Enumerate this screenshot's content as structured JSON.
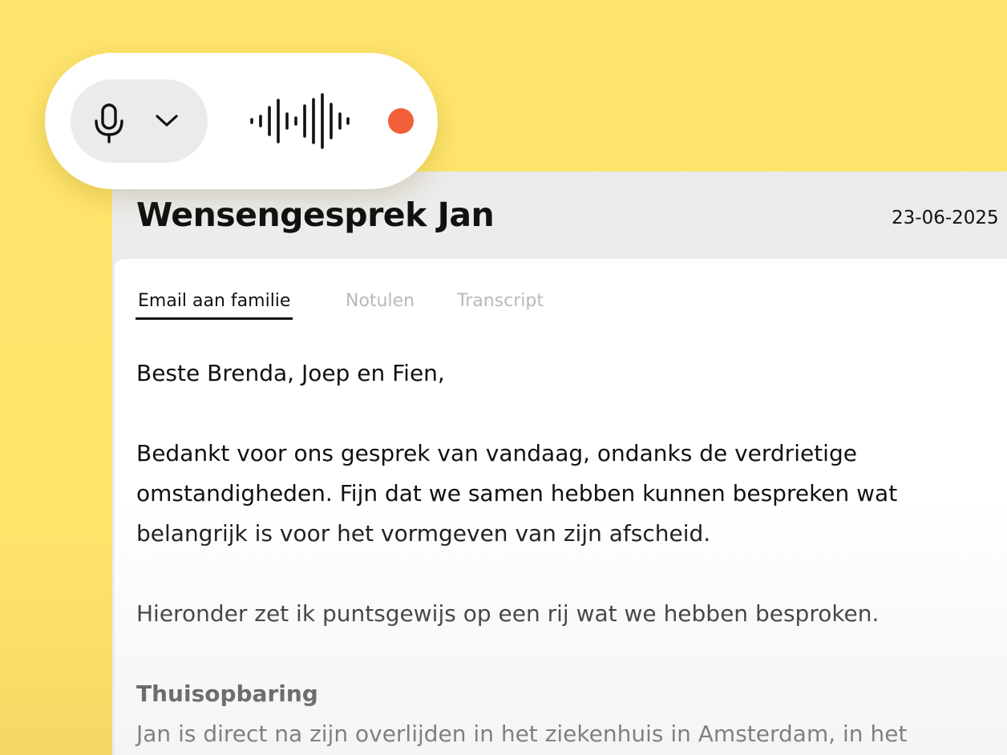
{
  "document": {
    "title": "Wensengesprek Jan",
    "date": "23-06-2025",
    "tabs": [
      {
        "label": "Email aan familie",
        "active": true
      },
      {
        "label": "Notulen",
        "active": false
      },
      {
        "label": "Transcript",
        "active": false
      }
    ],
    "email": {
      "greeting": "Beste Brenda, Joep en Fien,",
      "paragraph1": [
        "Bedankt voor ons gesprek van vandaag, ondanks de verdrietige",
        "omstandigheden. Fijn dat we samen hebben kunnen bespreken wat",
        "belangrijk is voor het vormgeven van zijn afscheid."
      ],
      "paragraph2": "Hieronder zet ik puntsgewijs op een rij wat we hebben besproken.",
      "section_heading": "Thuisopbaring",
      "section_text": "Jan is direct na zijn overlijden in het ziekenhuis in Amsterdam, in het"
    }
  },
  "recorder": {
    "microphone_icon": "microphone-icon",
    "dropdown_icon": "chevron-down-icon",
    "waveform_icon": "audio-waveform-icon",
    "recording_indicator_color": "#f2603a"
  },
  "colors": {
    "background": "#ffe56c",
    "accent_recording": "#f2603a",
    "inactive_tab": "#b9b9b9"
  }
}
